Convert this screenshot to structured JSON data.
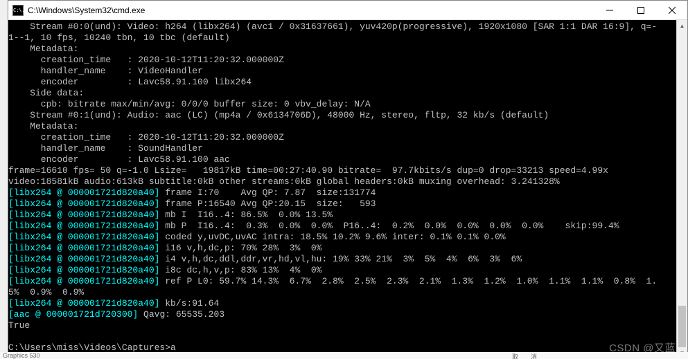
{
  "titlebar": {
    "icon_text": "C:\\.",
    "title": "C:\\Windows\\System32\\cmd.exe"
  },
  "lines": [
    {
      "cls": "",
      "text": "    Stream #0:0(und): Video: h264 (libx264) (avc1 / 0x31637661), yuv420p(progressive), 1920x1080 [SAR 1:1 DAR 16:9], q=-"
    },
    {
      "cls": "",
      "text": "1--1, 10 fps, 10240 tbn, 10 tbc (default)"
    },
    {
      "cls": "",
      "text": "    Metadata:"
    },
    {
      "cls": "",
      "text": "      creation_time   : 2020-10-12T11:20:32.000000Z"
    },
    {
      "cls": "",
      "text": "      handler_name    : VideoHandler"
    },
    {
      "cls": "",
      "text": "      encoder         : Lavc58.91.100 libx264"
    },
    {
      "cls": "",
      "text": "    Side data:"
    },
    {
      "cls": "",
      "text": "      cpb: bitrate max/min/avg: 0/0/0 buffer size: 0 vbv_delay: N/A"
    },
    {
      "cls": "",
      "text": "    Stream #0:1(und): Audio: aac (LC) (mp4a / 0x6134706D), 48000 Hz, stereo, fltp, 32 kb/s (default)"
    },
    {
      "cls": "",
      "text": "    Metadata:"
    },
    {
      "cls": "",
      "text": "      creation_time   : 2020-10-12T11:20:32.000000Z"
    },
    {
      "cls": "",
      "text": "      handler_name    : SoundHandler"
    },
    {
      "cls": "",
      "text": "      encoder         : Lavc58.91.100 aac"
    },
    {
      "cls": "",
      "text": "frame=16610 fps= 50 q=-1.0 Lsize=   19817kB time=00:27:40.90 bitrate=  97.7kbits/s dup=0 drop=33213 speed=4.99x"
    },
    {
      "cls": "",
      "text": "video:18581kB audio:613kB subtitle:0kB other streams:0kB global headers:0kB muxing overhead: 3.241328%"
    }
  ],
  "mixed": [
    {
      "tag": "[libx264 @ 000001721d820a40]",
      "rest": " frame I:70    Avg QP: 7.87  size:131774"
    },
    {
      "tag": "[libx264 @ 000001721d820a40]",
      "rest": " frame P:16540 Avg QP:20.15  size:   593"
    },
    {
      "tag": "[libx264 @ 000001721d820a40]",
      "rest": " mb I  I16..4: 86.5%  0.0% 13.5%"
    },
    {
      "tag": "[libx264 @ 000001721d820a40]",
      "rest": " mb P  I16..4:  0.3%  0.0%  0.0%  P16..4:  0.2%  0.0%  0.0%  0.0%  0.0%    skip:99.4%"
    },
    {
      "tag": "[libx264 @ 000001721d820a40]",
      "rest": " coded y,uvDC,uvAC intra: 18.5% 10.2% 9.6% inter: 0.1% 0.1% 0.0%"
    },
    {
      "tag": "[libx264 @ 000001721d820a40]",
      "rest": " i16 v,h,dc,p: 70% 28%  3%  0%"
    },
    {
      "tag": "[libx264 @ 000001721d820a40]",
      "rest": " i4 v,h,dc,ddl,ddr,vr,hd,vl,hu: 19% 33% 21%  3%  5%  4%  6%  3%  6%"
    },
    {
      "tag": "[libx264 @ 000001721d820a40]",
      "rest": " i8c dc,h,v,p: 83% 13%  4%  0%"
    },
    {
      "tag": "[libx264 @ 000001721d820a40]",
      "rest": " ref P L0: 59.7% 14.3%  6.7%  2.8%  2.5%  2.3%  2.1%  1.3%  1.2%  1.0%  1.1%  1.1%  0.8%  1."
    }
  ],
  "tail": [
    {
      "cls": "",
      "text": "5%  0.9%  0.9%"
    }
  ],
  "mixed2": [
    {
      "tag": "[libx264 @ 000001721d820a40]",
      "rest": " kb/s:91.64"
    },
    {
      "tag": "[aac @ 000001721d720300]",
      "rest": " Qavg: 65535.203"
    }
  ],
  "final": [
    {
      "cls": "",
      "text": "True"
    },
    {
      "cls": "",
      "text": ""
    },
    {
      "cls": "",
      "text": "C:\\Users\\miss\\Videos\\Captures>a"
    }
  ],
  "watermark": "CSDN @又蓝",
  "bottomstrip": {
    "left": " Graphics 530",
    "right": "取消"
  }
}
